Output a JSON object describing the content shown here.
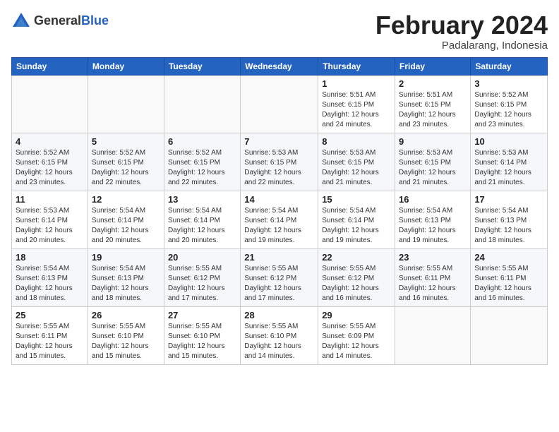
{
  "header": {
    "logo_general": "General",
    "logo_blue": "Blue",
    "month_title": "February 2024",
    "location": "Padalarang, Indonesia"
  },
  "days_of_week": [
    "Sunday",
    "Monday",
    "Tuesday",
    "Wednesday",
    "Thursday",
    "Friday",
    "Saturday"
  ],
  "weeks": [
    [
      {
        "day": "",
        "info": ""
      },
      {
        "day": "",
        "info": ""
      },
      {
        "day": "",
        "info": ""
      },
      {
        "day": "",
        "info": ""
      },
      {
        "day": "1",
        "info": "Sunrise: 5:51 AM\nSunset: 6:15 PM\nDaylight: 12 hours\nand 24 minutes."
      },
      {
        "day": "2",
        "info": "Sunrise: 5:51 AM\nSunset: 6:15 PM\nDaylight: 12 hours\nand 23 minutes."
      },
      {
        "day": "3",
        "info": "Sunrise: 5:52 AM\nSunset: 6:15 PM\nDaylight: 12 hours\nand 23 minutes."
      }
    ],
    [
      {
        "day": "4",
        "info": "Sunrise: 5:52 AM\nSunset: 6:15 PM\nDaylight: 12 hours\nand 23 minutes."
      },
      {
        "day": "5",
        "info": "Sunrise: 5:52 AM\nSunset: 6:15 PM\nDaylight: 12 hours\nand 22 minutes."
      },
      {
        "day": "6",
        "info": "Sunrise: 5:52 AM\nSunset: 6:15 PM\nDaylight: 12 hours\nand 22 minutes."
      },
      {
        "day": "7",
        "info": "Sunrise: 5:53 AM\nSunset: 6:15 PM\nDaylight: 12 hours\nand 22 minutes."
      },
      {
        "day": "8",
        "info": "Sunrise: 5:53 AM\nSunset: 6:15 PM\nDaylight: 12 hours\nand 21 minutes."
      },
      {
        "day": "9",
        "info": "Sunrise: 5:53 AM\nSunset: 6:15 PM\nDaylight: 12 hours\nand 21 minutes."
      },
      {
        "day": "10",
        "info": "Sunrise: 5:53 AM\nSunset: 6:14 PM\nDaylight: 12 hours\nand 21 minutes."
      }
    ],
    [
      {
        "day": "11",
        "info": "Sunrise: 5:53 AM\nSunset: 6:14 PM\nDaylight: 12 hours\nand 20 minutes."
      },
      {
        "day": "12",
        "info": "Sunrise: 5:54 AM\nSunset: 6:14 PM\nDaylight: 12 hours\nand 20 minutes."
      },
      {
        "day": "13",
        "info": "Sunrise: 5:54 AM\nSunset: 6:14 PM\nDaylight: 12 hours\nand 20 minutes."
      },
      {
        "day": "14",
        "info": "Sunrise: 5:54 AM\nSunset: 6:14 PM\nDaylight: 12 hours\nand 19 minutes."
      },
      {
        "day": "15",
        "info": "Sunrise: 5:54 AM\nSunset: 6:14 PM\nDaylight: 12 hours\nand 19 minutes."
      },
      {
        "day": "16",
        "info": "Sunrise: 5:54 AM\nSunset: 6:13 PM\nDaylight: 12 hours\nand 19 minutes."
      },
      {
        "day": "17",
        "info": "Sunrise: 5:54 AM\nSunset: 6:13 PM\nDaylight: 12 hours\nand 18 minutes."
      }
    ],
    [
      {
        "day": "18",
        "info": "Sunrise: 5:54 AM\nSunset: 6:13 PM\nDaylight: 12 hours\nand 18 minutes."
      },
      {
        "day": "19",
        "info": "Sunrise: 5:54 AM\nSunset: 6:13 PM\nDaylight: 12 hours\nand 18 minutes."
      },
      {
        "day": "20",
        "info": "Sunrise: 5:55 AM\nSunset: 6:12 PM\nDaylight: 12 hours\nand 17 minutes."
      },
      {
        "day": "21",
        "info": "Sunrise: 5:55 AM\nSunset: 6:12 PM\nDaylight: 12 hours\nand 17 minutes."
      },
      {
        "day": "22",
        "info": "Sunrise: 5:55 AM\nSunset: 6:12 PM\nDaylight: 12 hours\nand 16 minutes."
      },
      {
        "day": "23",
        "info": "Sunrise: 5:55 AM\nSunset: 6:11 PM\nDaylight: 12 hours\nand 16 minutes."
      },
      {
        "day": "24",
        "info": "Sunrise: 5:55 AM\nSunset: 6:11 PM\nDaylight: 12 hours\nand 16 minutes."
      }
    ],
    [
      {
        "day": "25",
        "info": "Sunrise: 5:55 AM\nSunset: 6:11 PM\nDaylight: 12 hours\nand 15 minutes."
      },
      {
        "day": "26",
        "info": "Sunrise: 5:55 AM\nSunset: 6:10 PM\nDaylight: 12 hours\nand 15 minutes."
      },
      {
        "day": "27",
        "info": "Sunrise: 5:55 AM\nSunset: 6:10 PM\nDaylight: 12 hours\nand 15 minutes."
      },
      {
        "day": "28",
        "info": "Sunrise: 5:55 AM\nSunset: 6:10 PM\nDaylight: 12 hours\nand 14 minutes."
      },
      {
        "day": "29",
        "info": "Sunrise: 5:55 AM\nSunset: 6:09 PM\nDaylight: 12 hours\nand 14 minutes."
      },
      {
        "day": "",
        "info": ""
      },
      {
        "day": "",
        "info": ""
      }
    ]
  ]
}
